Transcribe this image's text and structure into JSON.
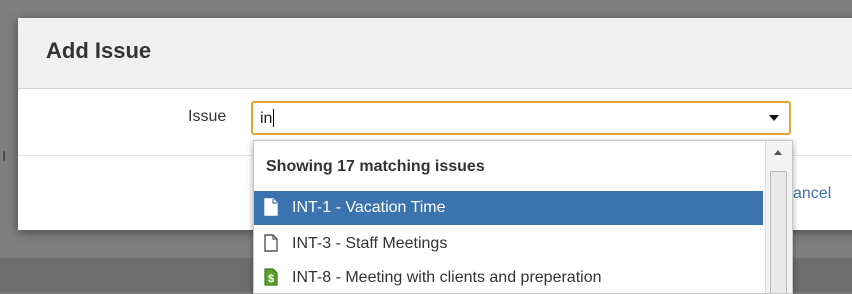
{
  "background": {
    "page_fragment": "I"
  },
  "modal": {
    "title": "Add Issue",
    "field_label": "Issue",
    "input_value": "in",
    "cancel_label": "ancel"
  },
  "dropdown": {
    "heading": "Showing 17 matching issues",
    "items": [
      {
        "label": "INT-1 - Vacation Time",
        "icon": "document-icon",
        "selected": true
      },
      {
        "label": "INT-3 - Staff Meetings",
        "icon": "document-icon",
        "selected": false
      },
      {
        "label": "INT-8 - Meeting with clients and preperation",
        "icon": "money-document-icon",
        "selected": false
      }
    ]
  },
  "colors": {
    "accent_blue": "#3b73af",
    "input_focus": "#e6a530",
    "money_icon_green": "#5aa02c"
  }
}
